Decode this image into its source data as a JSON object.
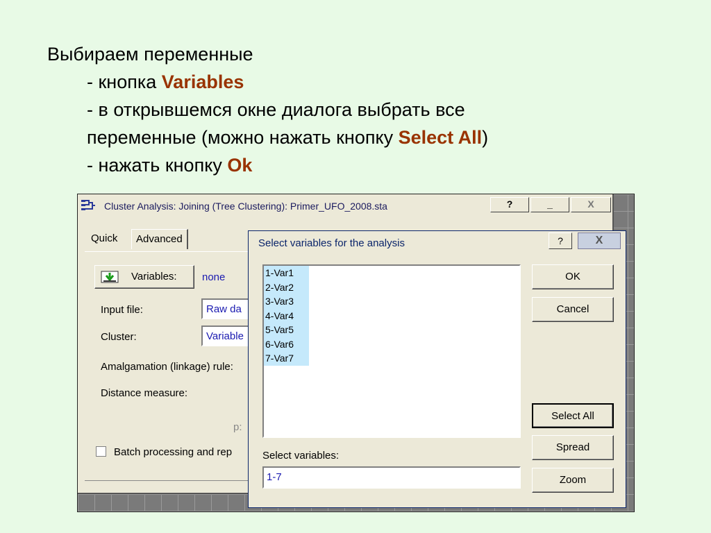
{
  "slide": {
    "line1": "Выбираем переменные",
    "line2_prefix": "- кнопка ",
    "line2_highlight": "Variables",
    "line3": "- в открывшемся окне диалога выбрать все",
    "line4_prefix": "переменные (можно нажать кнопку ",
    "line4_highlight": "Select All",
    "line4_suffix": ")",
    "line5_prefix": "- нажать кнопку ",
    "line5_highlight": "Ok",
    "highlight_color": "#993300"
  },
  "main_window": {
    "title": "Cluster Analysis: Joining (Tree Clustering): Primer_UFO_2008.sta",
    "help_btn": "?",
    "min_btn": "_",
    "close_btn": "X",
    "tabs": [
      "Quick",
      "Advanced"
    ],
    "variables_button": "Variables:",
    "variables_value": "none",
    "input_file_label": "Input file:",
    "input_file_value": "Raw da",
    "cluster_label": "Cluster:",
    "cluster_value": "Variable",
    "amalgamation_label": "Amalgamation (linkage) rule:",
    "distance_label": "Distance measure:",
    "p_label": "p:",
    "batch_label": "Batch processing and rep"
  },
  "dialog": {
    "title": "Select variables for the analysis",
    "help_btn": "?",
    "close_btn": "X",
    "variables": [
      "1-Var1",
      "2-Var2",
      "3-Var3",
      "4-Var4",
      "5-Var5",
      "6-Var6",
      "7-Var7"
    ],
    "select_label": "Select variables:",
    "select_value": "1-7",
    "buttons": {
      "ok": "OK",
      "cancel": "Cancel",
      "select_all": "Select All",
      "spread": "Spread",
      "zoom": "Zoom"
    }
  }
}
